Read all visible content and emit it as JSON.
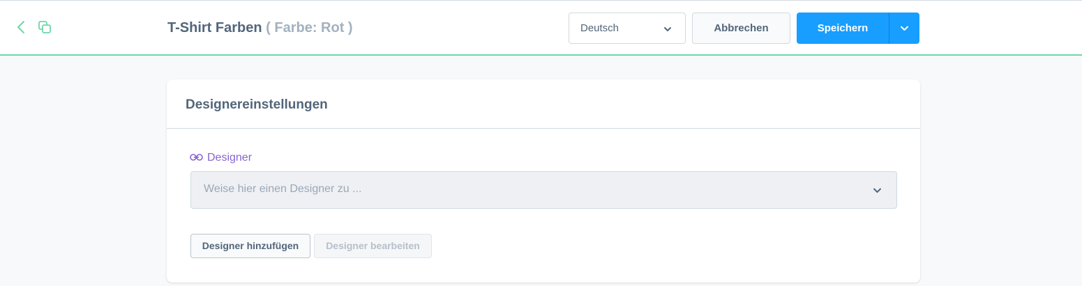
{
  "header": {
    "title": "T-Shirt Farben",
    "title_suffix": "( Farbe: Rot )",
    "language": "Deutsch",
    "cancel_label": "Abbrechen",
    "save_label": "Speichern"
  },
  "card": {
    "title": "Designereinstellungen",
    "field_label": "Designer",
    "select_placeholder": "Weise hier einen Designer zu ...",
    "add_button": "Designer hinzufügen",
    "edit_button": "Designer bearbeiten"
  },
  "icons": {
    "back": "chevron-left-icon",
    "duplicate": "duplicate-icon",
    "link": "link-icon",
    "dropdown": "chevron-down-icon"
  },
  "colors": {
    "primary": "#189eff",
    "accent_green": "#6fd6a8",
    "label_purple": "#8764cf"
  }
}
